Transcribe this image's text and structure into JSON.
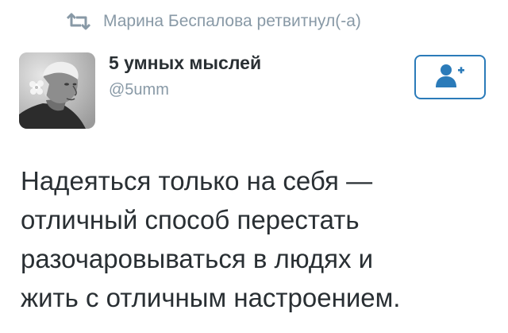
{
  "retweet": {
    "icon": "retweet-icon",
    "text": "Марина Беспалова ретвитнул(-а)"
  },
  "author": {
    "display_name": "5 умных мыслей",
    "handle": "@5umm",
    "avatar": "avatar-photo"
  },
  "follow_button": {
    "icon": "add-user-icon"
  },
  "tweet": {
    "lines": [
      "Надеяться только на себя —",
      "отличный способ перестать",
      "разочаровываться в людях и",
      "жить с отличным настроением."
    ]
  },
  "colors": {
    "meta_gray": "#8899a6",
    "text_dark": "#292f33",
    "accent_blue": "#2b7bb9"
  }
}
